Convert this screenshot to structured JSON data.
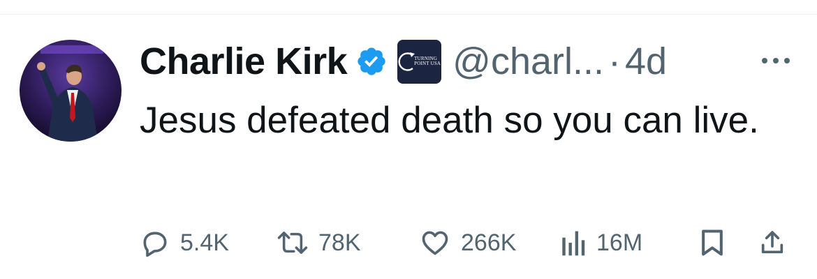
{
  "tweet": {
    "author": {
      "display_name": "Charlie Kirk",
      "handle": "@charl...",
      "verified": true,
      "affiliation_badge_text_1": "TURNING",
      "affiliation_badge_text_2": "POINT USA"
    },
    "separator": "·",
    "timestamp": "4d",
    "text": "Jesus defeated death so you can live.",
    "metrics": {
      "replies": "5.4K",
      "reposts": "78K",
      "likes": "266K",
      "views": "16M"
    }
  },
  "colors": {
    "text": "#0f1419",
    "secondary": "#536471",
    "verified": "#1d9bf0",
    "badge_bg": "#1b2440"
  },
  "icons": {
    "more": "more-dots-icon",
    "reply": "reply-bubble-icon",
    "repost": "repost-icon",
    "like": "heart-icon",
    "views": "analytics-bars-icon",
    "bookmark": "bookmark-icon",
    "share": "share-upload-icon"
  }
}
